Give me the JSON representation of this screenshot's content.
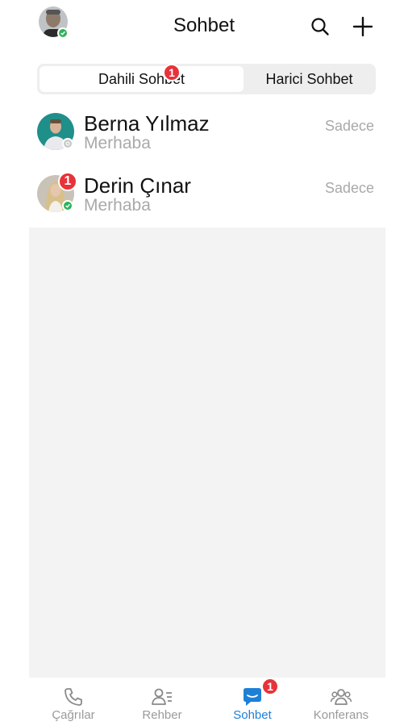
{
  "header": {
    "title": "Sohbet",
    "search_icon": "search-icon",
    "add_icon": "plus-icon",
    "status": "online"
  },
  "tabs": [
    {
      "label": "Dahili Sohbet",
      "active": true,
      "badge": "1"
    },
    {
      "label": "Harici Sohbet",
      "active": false
    }
  ],
  "chats": [
    {
      "name": "Berna Yılmaz",
      "preview": "Merhaba",
      "time": "Sadece",
      "status": "offline"
    },
    {
      "name": "Derin Çınar",
      "preview": "Merhaba",
      "time": "Sadece",
      "badge": "1",
      "status": "online"
    }
  ],
  "bottom_nav": [
    {
      "label": "Çağrılar",
      "icon": "phone-icon",
      "active": false
    },
    {
      "label": "Rehber",
      "icon": "contacts-icon",
      "active": false
    },
    {
      "label": "Sohbet",
      "icon": "chat-icon",
      "active": true,
      "badge": "1"
    },
    {
      "label": "Konferans",
      "icon": "conference-icon",
      "active": false
    }
  ],
  "colors": {
    "accent": "#1e7fd6",
    "badge": "#e8323a",
    "online": "#2db35a",
    "muted_text": "#a9a9a9"
  }
}
